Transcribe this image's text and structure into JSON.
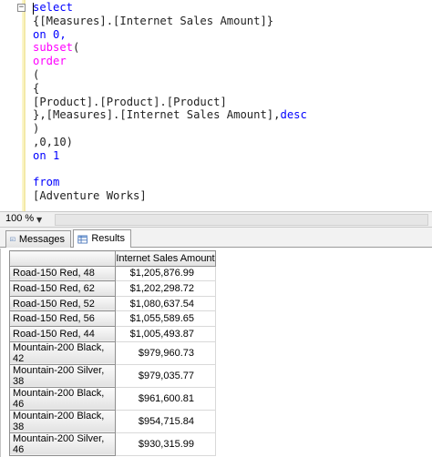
{
  "editor": {
    "lines": [
      [
        {
          "t": "select",
          "c": "kw"
        }
      ],
      [
        {
          "t": "{[Measures].[Internet Sales Amount]}",
          "c": "tx"
        }
      ],
      [
        {
          "t": "on 0,",
          "c": "kw"
        }
      ],
      [
        {
          "t": "subset",
          "c": "fn"
        },
        {
          "t": "(",
          "c": "tx"
        }
      ],
      [
        {
          "t": "order",
          "c": "fn"
        }
      ],
      [
        {
          "t": "(",
          "c": "tx"
        }
      ],
      [
        {
          "t": "{",
          "c": "tx"
        }
      ],
      [
        {
          "t": "[Product].[Product].[Product]",
          "c": "tx"
        }
      ],
      [
        {
          "t": "},[Measures].[Internet Sales Amount],",
          "c": "tx"
        },
        {
          "t": "desc",
          "c": "kw"
        }
      ],
      [
        {
          "t": ")",
          "c": "tx"
        }
      ],
      [
        {
          "t": ",0,10)",
          "c": "tx"
        }
      ],
      [
        {
          "t": "on 1",
          "c": "kw"
        }
      ],
      [
        {
          "t": "",
          "c": "tx"
        }
      ],
      [
        {
          "t": "from",
          "c": "kw"
        }
      ],
      [
        {
          "t": "[Adventure Works]",
          "c": "tx"
        }
      ]
    ],
    "collapse_glyph": "−"
  },
  "zoom": {
    "value": "100 %",
    "arrow": "▼"
  },
  "tabs": {
    "messages": "Messages",
    "results": "Results"
  },
  "grid": {
    "column_header": "Internet Sales Amount",
    "rows": [
      {
        "label": "Road-150 Red, 48",
        "value": "$1,205,876.99"
      },
      {
        "label": "Road-150 Red, 62",
        "value": "$1,202,298.72"
      },
      {
        "label": "Road-150 Red, 52",
        "value": "$1,080,637.54"
      },
      {
        "label": "Road-150 Red, 56",
        "value": "$1,055,589.65"
      },
      {
        "label": "Road-150 Red, 44",
        "value": "$1,005,493.87"
      },
      {
        "label": "Mountain-200 Black, 42",
        "value": "$979,960.73"
      },
      {
        "label": "Mountain-200 Silver, 38",
        "value": "$979,035.77"
      },
      {
        "label": "Mountain-200 Black, 46",
        "value": "$961,600.81"
      },
      {
        "label": "Mountain-200 Black, 38",
        "value": "$954,715.84"
      },
      {
        "label": "Mountain-200 Silver, 46",
        "value": "$930,315.99"
      }
    ]
  },
  "colors": {
    "keyword": "#0000ff",
    "function": "#ff00ff",
    "text": "#222222",
    "gutter": "#fbf6c9"
  }
}
